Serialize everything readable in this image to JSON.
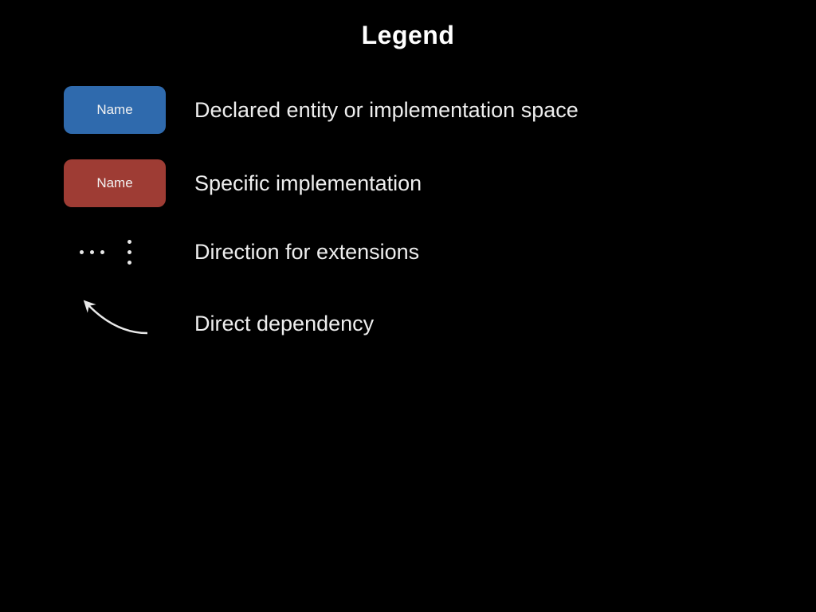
{
  "title": "Legend",
  "items": [
    {
      "badge_label": "Name",
      "description": "Declared entity or implementation space"
    },
    {
      "badge_label": "Name",
      "description": "Specific implementation"
    },
    {
      "description": "Direction for extensions"
    },
    {
      "description": "Direct dependency"
    }
  ],
  "colors": {
    "blue": "#2f6aad",
    "red": "#9e3c34",
    "background": "#000000",
    "text": "#ffffff"
  }
}
